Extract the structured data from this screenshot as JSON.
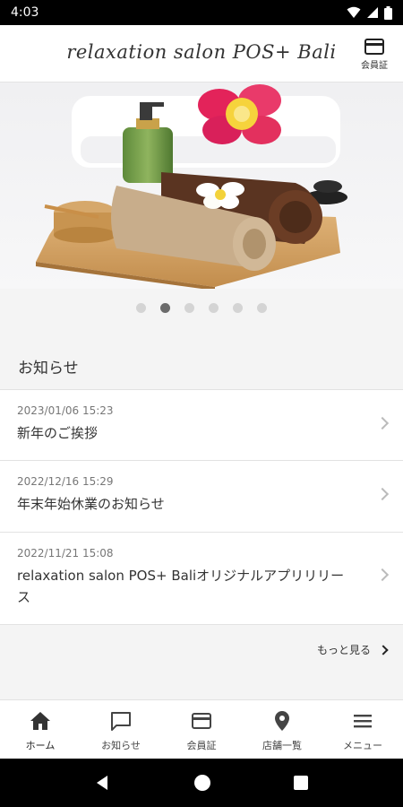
{
  "status_bar": {
    "time": "4:03"
  },
  "header": {
    "brand": "relaxation salon POS+ Bali",
    "member_label": "会員証"
  },
  "carousel": {
    "total": 6,
    "active": 1
  },
  "news": {
    "section_title": "お知らせ",
    "items": [
      {
        "date": "2023/01/06 15:23",
        "title": "新年のご挨拶"
      },
      {
        "date": "2022/12/16 15:29",
        "title": "年末年始休業のお知らせ"
      },
      {
        "date": "2022/11/21 15:08",
        "title": "relaxation salon POS+ Baliオリジナルアプリリリース"
      }
    ],
    "more_label": "もっと見る"
  },
  "bottom_nav": {
    "items": [
      {
        "label": "ホーム",
        "icon": "home-icon"
      },
      {
        "label": "お知らせ",
        "icon": "chat-icon"
      },
      {
        "label": "会員証",
        "icon": "card-icon"
      },
      {
        "label": "店舗一覧",
        "icon": "location-icon"
      },
      {
        "label": "メニュー",
        "icon": "menu-icon"
      }
    ]
  },
  "colors": {
    "accent": "#333333",
    "dot_active": "#6b6b6b",
    "dot_inactive": "#d4d4d4"
  }
}
